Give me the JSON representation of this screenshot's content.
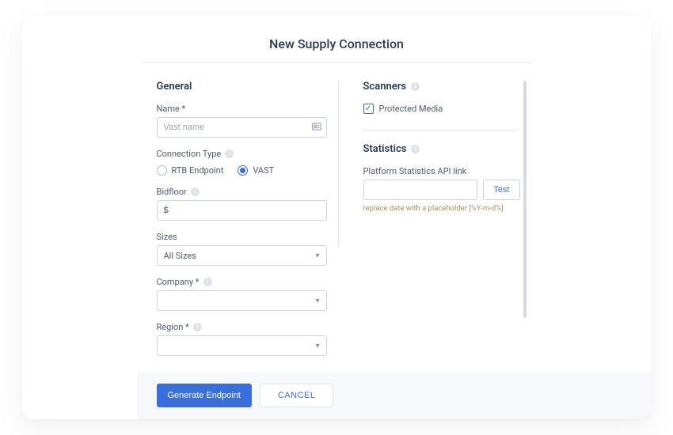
{
  "title": "New Supply Connection",
  "general": {
    "heading": "General",
    "name_label": "Name *",
    "name_placeholder": "Vast name",
    "name_value": "",
    "connection_type_label": "Connection Type",
    "connection_options": [
      {
        "label": "RTB Endpoint",
        "selected": false
      },
      {
        "label": "VAST",
        "selected": true
      }
    ],
    "bidfloor_label": "Bidfloor",
    "bidfloor_value": "$",
    "sizes_label": "Sizes",
    "sizes_value": "All Sizes",
    "company_label": "Company *",
    "company_value": "",
    "region_label": "Region *",
    "region_value": ""
  },
  "scanners": {
    "heading": "Scanners",
    "protected_media_label": "Protected Media",
    "protected_media_checked": true
  },
  "statistics": {
    "heading": "Statistics",
    "api_label": "Platform Statistics API link",
    "api_value": "",
    "test_label": "Test",
    "hint": "replace date with a placeholder [%Y-m-d%]"
  },
  "footer": {
    "generate_label": "Generate Endpoint",
    "cancel_label": "CANCEL"
  }
}
